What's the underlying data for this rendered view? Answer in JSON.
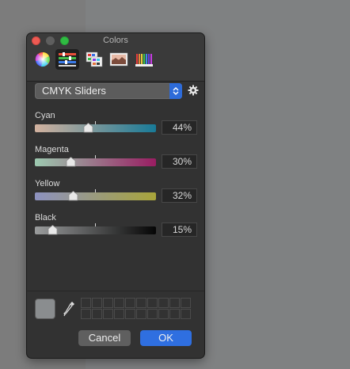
{
  "window": {
    "title": "Colors"
  },
  "toolbar": {
    "tabs": [
      {
        "name": "color-wheel",
        "icon": "color-wheel-icon",
        "active": false
      },
      {
        "name": "color-sliders",
        "icon": "sliders-icon",
        "active": true
      },
      {
        "name": "color-palettes",
        "icon": "palette-grid-icon",
        "active": false
      },
      {
        "name": "image-palettes",
        "icon": "image-palette-icon",
        "active": false
      },
      {
        "name": "pencils",
        "icon": "pencils-icon",
        "active": false
      }
    ]
  },
  "mode_selector": {
    "selected": "CMYK Sliders"
  },
  "sliders": [
    {
      "label": "Cyan",
      "value": "44%",
      "level": 0.44,
      "gradient": [
        "#d3b29f",
        "#187a97"
      ]
    },
    {
      "label": "Magenta",
      "value": "30%",
      "level": 0.3,
      "gradient": [
        "#9ccab0",
        "#9a1d62"
      ]
    },
    {
      "label": "Yellow",
      "value": "32%",
      "level": 0.32,
      "gradient": [
        "#8d92c0",
        "#a8a43a"
      ]
    },
    {
      "label": "Black",
      "value": "15%",
      "level": 0.15,
      "gradient": [
        "#9a9c9d",
        "#050505"
      ]
    }
  ],
  "current_color": "#8a8d8f",
  "buttons": {
    "cancel": "Cancel",
    "ok": "OK"
  },
  "colors": {
    "accent": "#2f6fe0",
    "panel": "#323232"
  }
}
